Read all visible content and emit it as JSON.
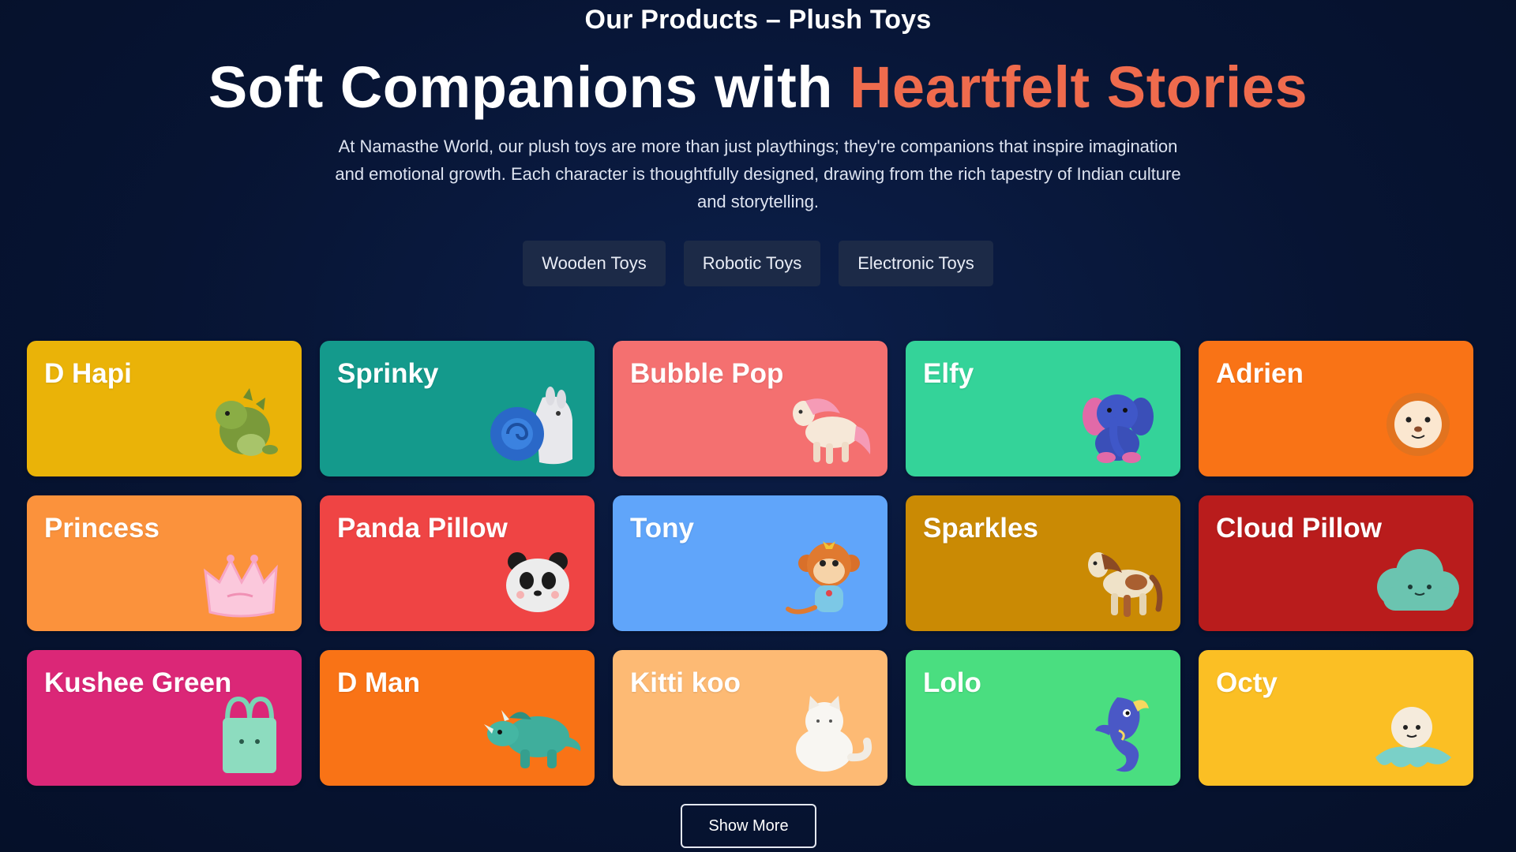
{
  "header": {
    "eyebrow": "Our Products – Plush Toys",
    "headline_main": "Soft Companions with ",
    "headline_accent": "Heartfelt Stories",
    "intro": "At Namasthe World, our plush toys are more than just playthings; they're companions that inspire imagination and emotional growth. Each character is thoughtfully designed, drawing from the rich tapestry of Indian culture and storytelling."
  },
  "colors": {
    "background": "#071433",
    "accent": "#ef6b4d",
    "filter_button": "#1c2a47"
  },
  "filters": [
    {
      "label": "Wooden Toys"
    },
    {
      "label": "Robotic Toys"
    },
    {
      "label": "Electronic Toys"
    }
  ],
  "products": [
    {
      "name": "D Hapi",
      "color": "#eab308",
      "icon": "green-dragon-plush-icon"
    },
    {
      "name": "Sprinky",
      "color": "#149a8c",
      "icon": "snail-plush-icon"
    },
    {
      "name": "Bubble Pop",
      "color": "#f47070",
      "icon": "pony-plush-icon"
    },
    {
      "name": "Elfy",
      "color": "#34d399",
      "icon": "elephant-plush-icon"
    },
    {
      "name": "Adrien",
      "color": "#f97316",
      "icon": "lion-plush-icon"
    },
    {
      "name": "Princess",
      "color": "#fb923c",
      "icon": "crown-plush-icon"
    },
    {
      "name": "Panda Pillow",
      "color": "#ef4444",
      "icon": "panda-pillow-icon"
    },
    {
      "name": "Tony",
      "color": "#60a5fa",
      "icon": "monkey-plush-icon"
    },
    {
      "name": "Sparkles",
      "color": "#ca8a04",
      "icon": "horse-plush-icon"
    },
    {
      "name": "Cloud Pillow",
      "color": "#b91c1c",
      "icon": "cloud-pillow-icon"
    },
    {
      "name": "Kushee Green",
      "color": "#db2777",
      "icon": "green-tote-bag-icon"
    },
    {
      "name": "D Man",
      "color": "#f97316",
      "icon": "triceratops-plush-icon"
    },
    {
      "name": "Kitti koo",
      "color": "#fdba74",
      "icon": "white-cat-plush-icon"
    },
    {
      "name": "Lolo",
      "color": "#4ade80",
      "icon": "seahorse-plush-icon"
    },
    {
      "name": "Octy",
      "color": "#fbbf24",
      "icon": "octopus-plush-icon"
    }
  ],
  "show_more_label": "Show More"
}
